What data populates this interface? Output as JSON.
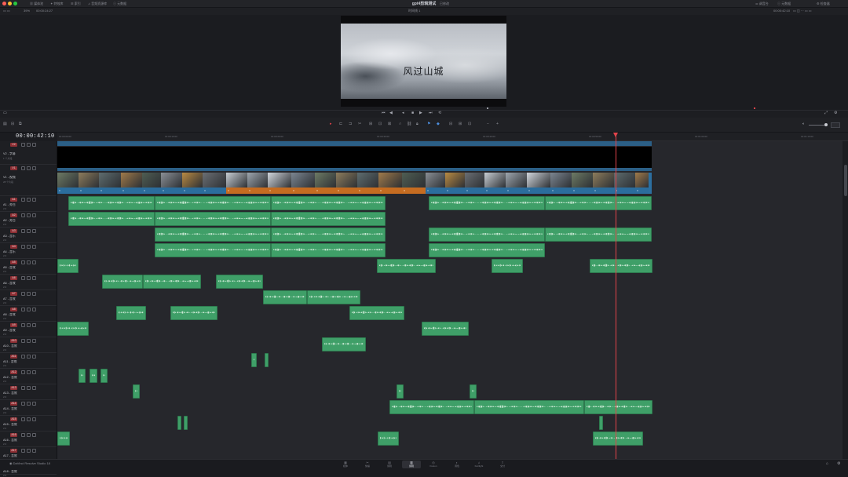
{
  "window": {
    "project_title": "gpt4剪辑测试",
    "menu_items": [
      "媒体池",
      "特效库",
      "索引",
      "音频资源库",
      "元数据"
    ],
    "right_items": [
      "调音台",
      "元数据",
      "检查器"
    ],
    "edited_label": "已修改"
  },
  "subbar": {
    "zoom": "39%",
    "source_tc": "00:00:24:27",
    "timeline_name": "时间线 1",
    "right_tc": "00:00:42:10"
  },
  "viewer": {
    "caption": "风过山城"
  },
  "timeline": {
    "timecode": "00:00:42:10",
    "ruler_ticks": [
      "01:00:00:00",
      "01:00:10:00",
      "01:00:20:00",
      "01:00:30:00",
      "01:00:40:00",
      "01:00:50:00",
      "01:01:00:00",
      "01:01:10:00"
    ],
    "tracks": [
      {
        "badge": "V2",
        "name": "V2 - 字幕",
        "sub": "1 个片段"
      },
      {
        "badge": "V1",
        "name": "V1 - 视频",
        "sub": "28 个片段"
      },
      {
        "badge": "A1",
        "name": "A1 - 旁白",
        "sub": "2.0"
      },
      {
        "badge": "A2",
        "name": "A2 - 旁白",
        "sub": "2.0"
      },
      {
        "badge": "A3",
        "name": "A3 - 音乐",
        "sub": "2.0"
      },
      {
        "badge": "A4",
        "name": "A4 - 音乐",
        "sub": "2.0"
      },
      {
        "badge": "A5",
        "name": "A5 - 音效",
        "sub": "2.0"
      },
      {
        "badge": "A6",
        "name": "A6 - 音效",
        "sub": "2.0"
      },
      {
        "badge": "A7",
        "name": "A7 - 音效",
        "sub": "2.0"
      },
      {
        "badge": "A8",
        "name": "A8 - 音效",
        "sub": "2.0"
      },
      {
        "badge": "A9",
        "name": "A9 - 音效",
        "sub": "2.0"
      },
      {
        "badge": "A10",
        "name": "A10 - 音效",
        "sub": "2.0"
      },
      {
        "badge": "A11",
        "name": "A11 - 音效",
        "sub": "2.0"
      },
      {
        "badge": "A12",
        "name": "A12 - 音效",
        "sub": "2.0"
      },
      {
        "badge": "A13",
        "name": "A13 - 音效",
        "sub": "2.0"
      },
      {
        "badge": "A14",
        "name": "A14 - 音效",
        "sub": "2.0"
      },
      {
        "badge": "A15",
        "name": "A15 - 音效",
        "sub": "2.0"
      },
      {
        "badge": "A16",
        "name": "A16 - 音效",
        "sub": "2.0"
      },
      {
        "badge": "A17",
        "name": "A17 - 音效",
        "sub": "2.0"
      },
      {
        "badge": "A18",
        "name": "A18 - 音效",
        "sub": "2.0"
      }
    ]
  },
  "pages": [
    "媒体",
    "快编",
    "剪辑",
    "Fusion",
    "调色",
    "Fairlight",
    "交付"
  ],
  "active_page": "剪辑",
  "brand": "DaVinci Resolve Studio 18"
}
